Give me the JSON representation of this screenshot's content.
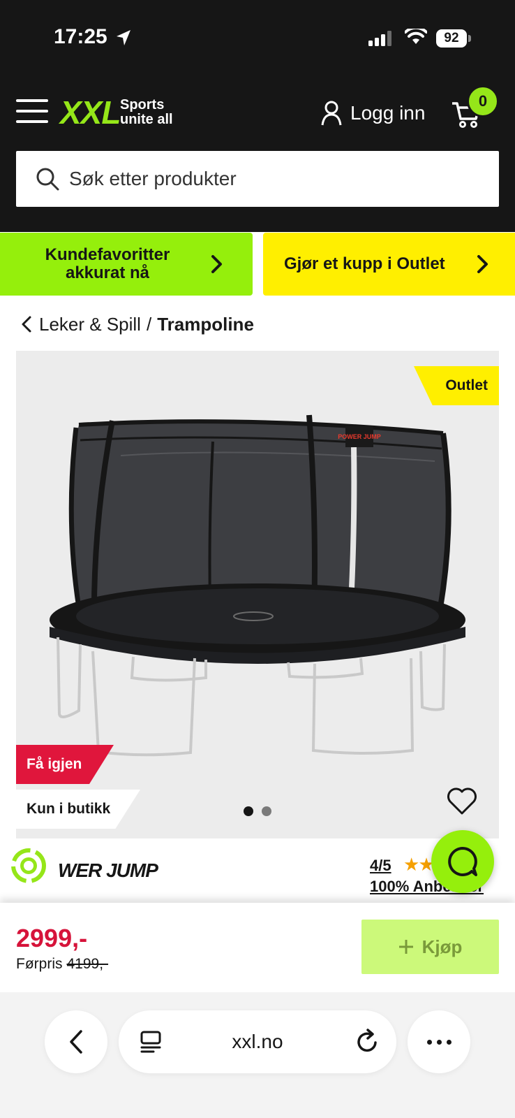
{
  "status_bar": {
    "time": "17:25",
    "battery": "92",
    "icons": [
      "location-arrow-icon",
      "cellular-signal-icon",
      "wifi-icon",
      "battery-icon"
    ]
  },
  "header": {
    "logo": "XXL",
    "tagline_line1": "Sports",
    "tagline_line2": "unite all",
    "login_label": "Logg inn",
    "cart_count": "0",
    "search_placeholder": "Søk etter produkter",
    "colors": {
      "background": "#161616",
      "brand_green": "#95e619"
    }
  },
  "promo": {
    "left_line1": "Kundefavoritter",
    "left_line2": "akkurat nå",
    "right_label": "Gjør et kupp i Outlet",
    "colors": {
      "left": "#95ef0c",
      "right": "#ffef00"
    }
  },
  "breadcrumb": {
    "parent": "Leker & Spill",
    "separator": "/",
    "current": "Trampoline"
  },
  "gallery": {
    "outlet_badge": "Outlet",
    "return_badge": "Få igjen",
    "store_badge": "Kun i butikk",
    "image_count": 2,
    "active_image": 1,
    "image_logo_text": "POWER JUMP"
  },
  "product": {
    "brand": " WER JUMP",
    "rating": "4/5",
    "rating_value": 4,
    "rating_max": 5,
    "recommend": "100% Anbefaler"
  },
  "price": {
    "current": "2999,-",
    "previous_label": "Førpris",
    "previous": "4199,-",
    "buy_label": "Kjøp",
    "colors": {
      "price": "#d6133a",
      "buy_button": "#ccf97a"
    }
  },
  "browser": {
    "url": "xxl.no"
  }
}
